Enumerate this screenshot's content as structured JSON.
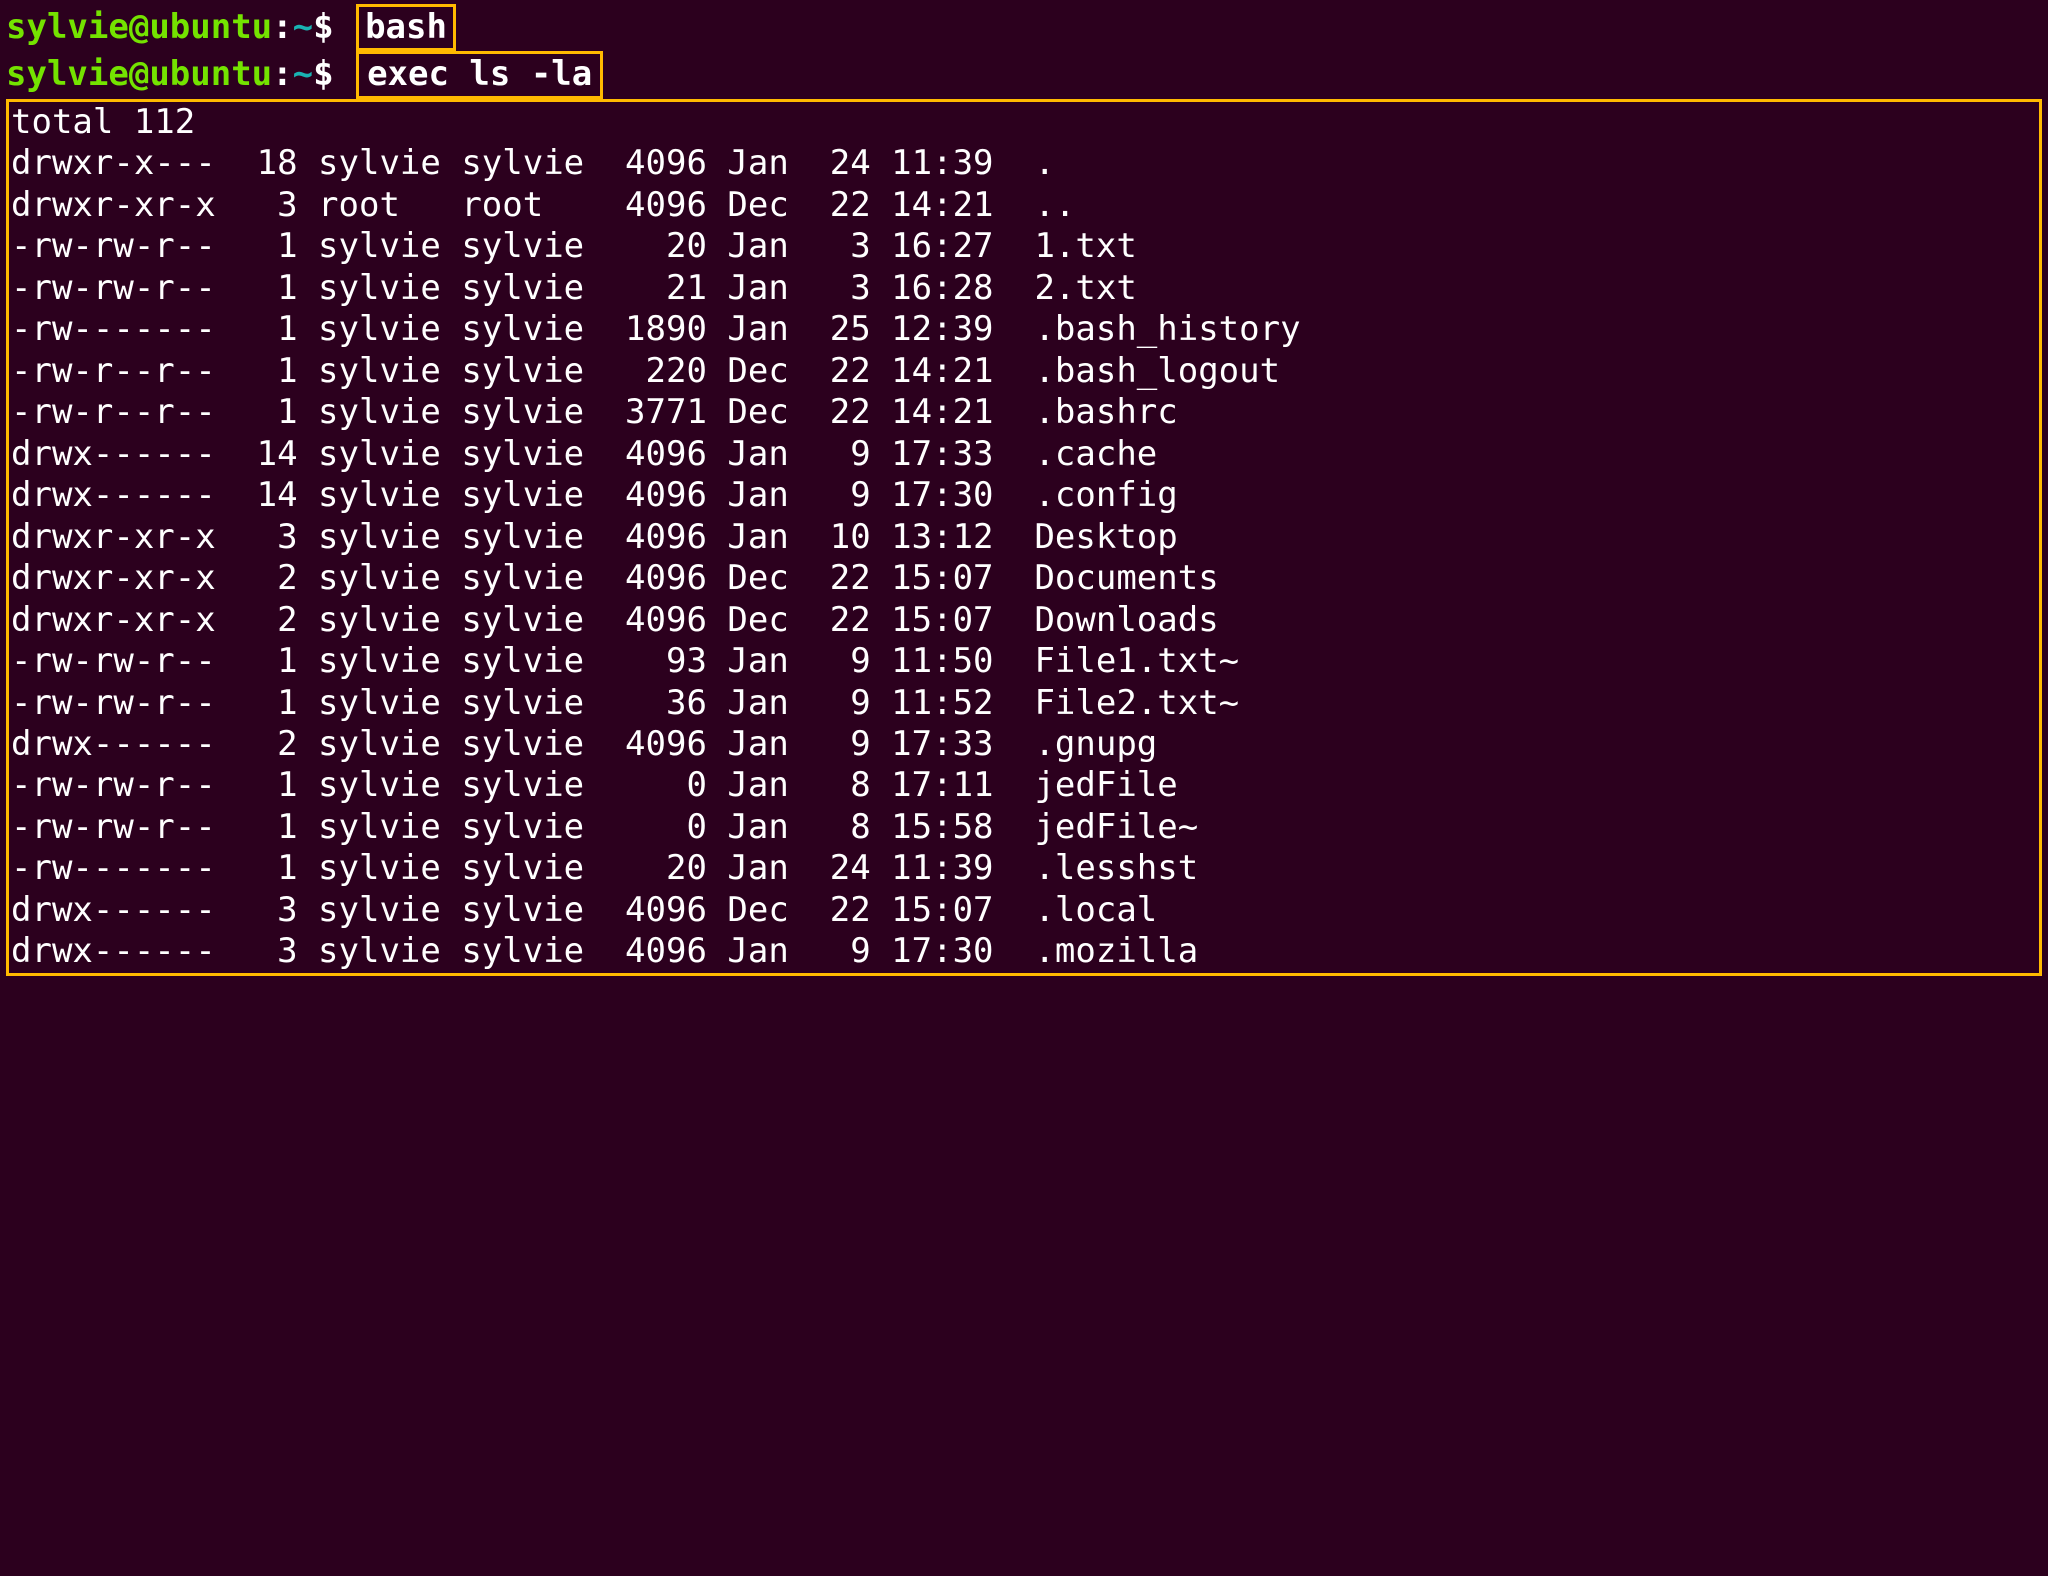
{
  "prompt": {
    "user": "sylvie",
    "at": "@",
    "host": "ubuntu",
    "colon": ":",
    "path": "~",
    "dollar": "$"
  },
  "commands": {
    "cmd1": "bash",
    "cmd2": "exec ls -la"
  },
  "total_line": "total 112",
  "rows": [
    {
      "perm": "drwxr-x---",
      "lnk": "18",
      "own": "sylvie",
      "grp": "sylvie",
      "sz": "4096",
      "mon": "Jan",
      "day": "24",
      "tm": "11:39",
      "nm": "."
    },
    {
      "perm": "drwxr-xr-x",
      "lnk": "3",
      "own": "root",
      "grp": "root",
      "sz": "4096",
      "mon": "Dec",
      "day": "22",
      "tm": "14:21",
      "nm": ".."
    },
    {
      "perm": "-rw-rw-r--",
      "lnk": "1",
      "own": "sylvie",
      "grp": "sylvie",
      "sz": "20",
      "mon": "Jan",
      "day": "3",
      "tm": "16:27",
      "nm": "1.txt"
    },
    {
      "perm": "-rw-rw-r--",
      "lnk": "1",
      "own": "sylvie",
      "grp": "sylvie",
      "sz": "21",
      "mon": "Jan",
      "day": "3",
      "tm": "16:28",
      "nm": "2.txt"
    },
    {
      "perm": "-rw-------",
      "lnk": "1",
      "own": "sylvie",
      "grp": "sylvie",
      "sz": "1890",
      "mon": "Jan",
      "day": "25",
      "tm": "12:39",
      "nm": ".bash_history"
    },
    {
      "perm": "-rw-r--r--",
      "lnk": "1",
      "own": "sylvie",
      "grp": "sylvie",
      "sz": "220",
      "mon": "Dec",
      "day": "22",
      "tm": "14:21",
      "nm": ".bash_logout"
    },
    {
      "perm": "-rw-r--r--",
      "lnk": "1",
      "own": "sylvie",
      "grp": "sylvie",
      "sz": "3771",
      "mon": "Dec",
      "day": "22",
      "tm": "14:21",
      "nm": ".bashrc"
    },
    {
      "perm": "drwx------",
      "lnk": "14",
      "own": "sylvie",
      "grp": "sylvie",
      "sz": "4096",
      "mon": "Jan",
      "day": "9",
      "tm": "17:33",
      "nm": ".cache"
    },
    {
      "perm": "drwx------",
      "lnk": "14",
      "own": "sylvie",
      "grp": "sylvie",
      "sz": "4096",
      "mon": "Jan",
      "day": "9",
      "tm": "17:30",
      "nm": ".config"
    },
    {
      "perm": "drwxr-xr-x",
      "lnk": "3",
      "own": "sylvie",
      "grp": "sylvie",
      "sz": "4096",
      "mon": "Jan",
      "day": "10",
      "tm": "13:12",
      "nm": "Desktop"
    },
    {
      "perm": "drwxr-xr-x",
      "lnk": "2",
      "own": "sylvie",
      "grp": "sylvie",
      "sz": "4096",
      "mon": "Dec",
      "day": "22",
      "tm": "15:07",
      "nm": "Documents"
    },
    {
      "perm": "drwxr-xr-x",
      "lnk": "2",
      "own": "sylvie",
      "grp": "sylvie",
      "sz": "4096",
      "mon": "Dec",
      "day": "22",
      "tm": "15:07",
      "nm": "Downloads"
    },
    {
      "perm": "-rw-rw-r--",
      "lnk": "1",
      "own": "sylvie",
      "grp": "sylvie",
      "sz": "93",
      "mon": "Jan",
      "day": "9",
      "tm": "11:50",
      "nm": "File1.txt~"
    },
    {
      "perm": "-rw-rw-r--",
      "lnk": "1",
      "own": "sylvie",
      "grp": "sylvie",
      "sz": "36",
      "mon": "Jan",
      "day": "9",
      "tm": "11:52",
      "nm": "File2.txt~"
    },
    {
      "perm": "drwx------",
      "lnk": "2",
      "own": "sylvie",
      "grp": "sylvie",
      "sz": "4096",
      "mon": "Jan",
      "day": "9",
      "tm": "17:33",
      "nm": ".gnupg"
    },
    {
      "perm": "-rw-rw-r--",
      "lnk": "1",
      "own": "sylvie",
      "grp": "sylvie",
      "sz": "0",
      "mon": "Jan",
      "day": "8",
      "tm": "17:11",
      "nm": "jedFile"
    },
    {
      "perm": "-rw-rw-r--",
      "lnk": "1",
      "own": "sylvie",
      "grp": "sylvie",
      "sz": "0",
      "mon": "Jan",
      "day": "8",
      "tm": "15:58",
      "nm": "jedFile~"
    },
    {
      "perm": "-rw-------",
      "lnk": "1",
      "own": "sylvie",
      "grp": "sylvie",
      "sz": "20",
      "mon": "Jan",
      "day": "24",
      "tm": "11:39",
      "nm": ".lesshst"
    },
    {
      "perm": "drwx------",
      "lnk": "3",
      "own": "sylvie",
      "grp": "sylvie",
      "sz": "4096",
      "mon": "Dec",
      "day": "22",
      "tm": "15:07",
      "nm": ".local"
    },
    {
      "perm": "drwx------",
      "lnk": "3",
      "own": "sylvie",
      "grp": "sylvie",
      "sz": "4096",
      "mon": "Jan",
      "day": "9",
      "tm": "17:30",
      "nm": ".mozilla"
    }
  ]
}
